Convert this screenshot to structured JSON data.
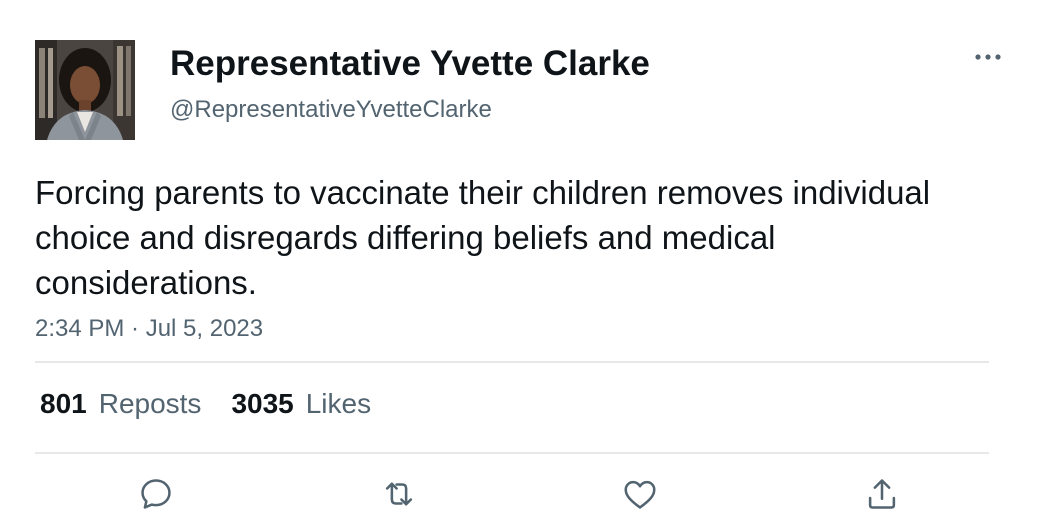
{
  "user": {
    "display_name": "Representative Yvette Clarke",
    "handle": "@RepresentativeYvetteClarke",
    "avatar_icon": "avatar-photo"
  },
  "tweet": {
    "text": "Forcing parents to vaccinate their children removes individual choice and disregards differing beliefs and medical considerations.",
    "timestamp": "2:34 PM · Jul 5, 2023"
  },
  "stats": {
    "reposts_count": "801",
    "reposts_label": "Reposts",
    "likes_count": "3035",
    "likes_label": "Likes"
  },
  "actions": {
    "icons": [
      "reply-icon",
      "repost-icon",
      "like-icon",
      "share-icon"
    ]
  },
  "colors": {
    "text_primary": "#0f1419",
    "text_secondary": "#536471",
    "divider": "#e6e8ea",
    "icon": "#536471"
  }
}
